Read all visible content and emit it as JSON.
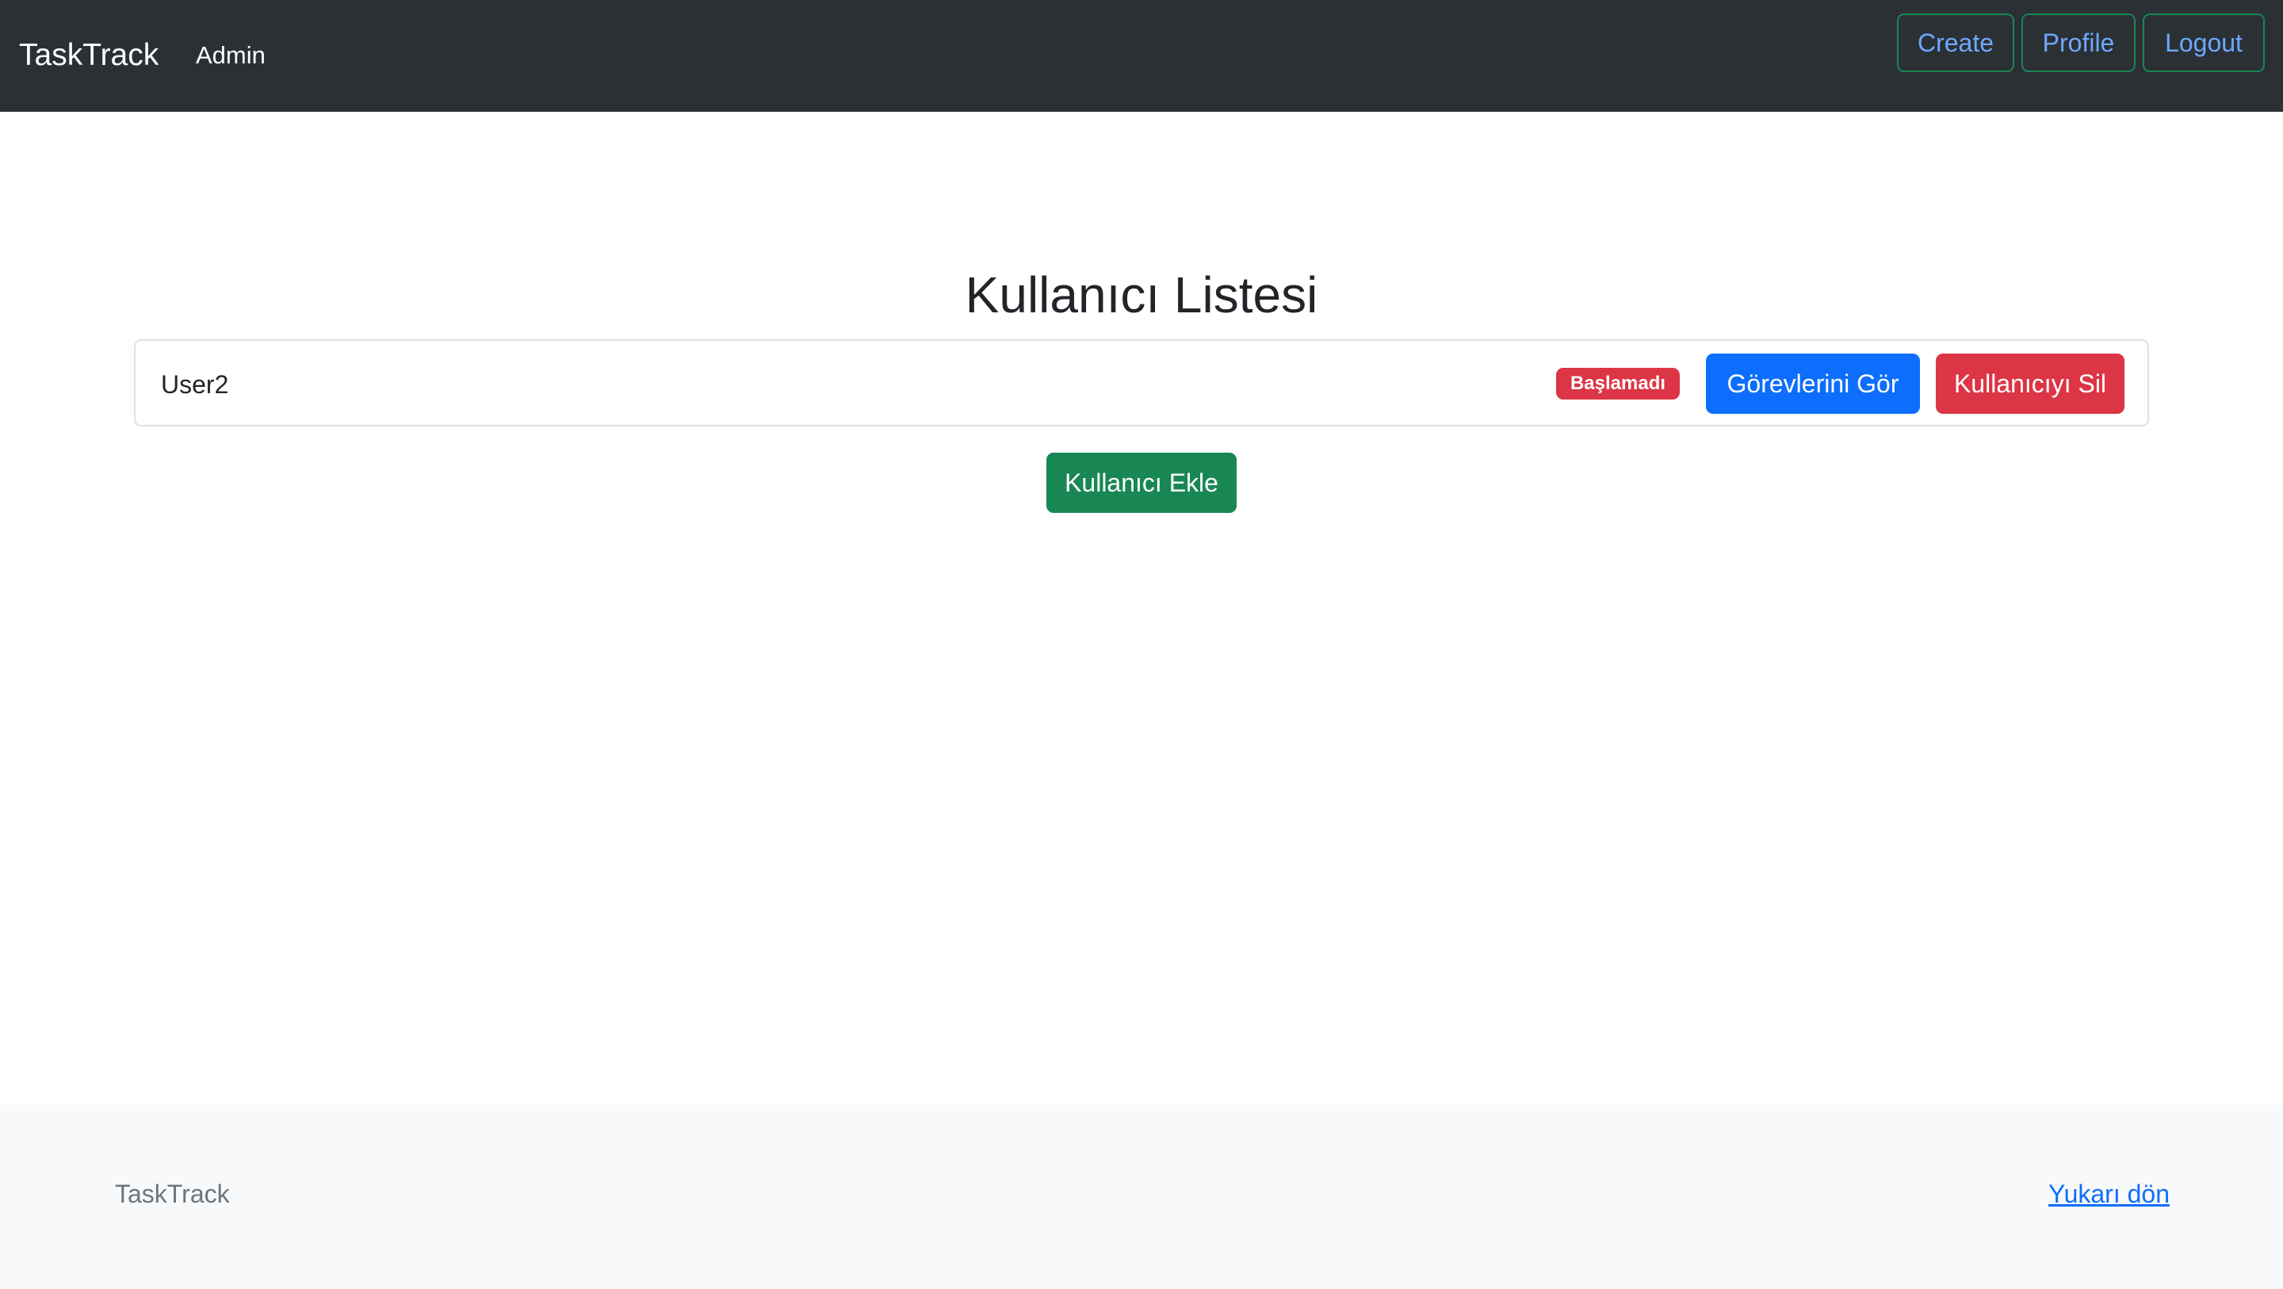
{
  "navbar": {
    "brand": "TaskTrack",
    "admin_link": "Admin",
    "buttons": {
      "create": "Create",
      "profile": "Profile",
      "logout": "Logout"
    }
  },
  "main": {
    "title": "Kullanıcı Listesi",
    "users": [
      {
        "name": "User2",
        "status": "Başlamadı",
        "view_tasks_label": "Görevlerini Gör",
        "delete_label": "Kullanıcıyı Sil"
      }
    ],
    "add_user_label": "Kullanıcı Ekle"
  },
  "footer": {
    "brand": "TaskTrack",
    "back_to_top": "Yukarı dön"
  },
  "colors": {
    "navbar_bg": "#2b3035",
    "primary": "#0d6efd",
    "danger": "#dc3545",
    "success": "#198754",
    "footer_bg": "#f8f9fa"
  }
}
